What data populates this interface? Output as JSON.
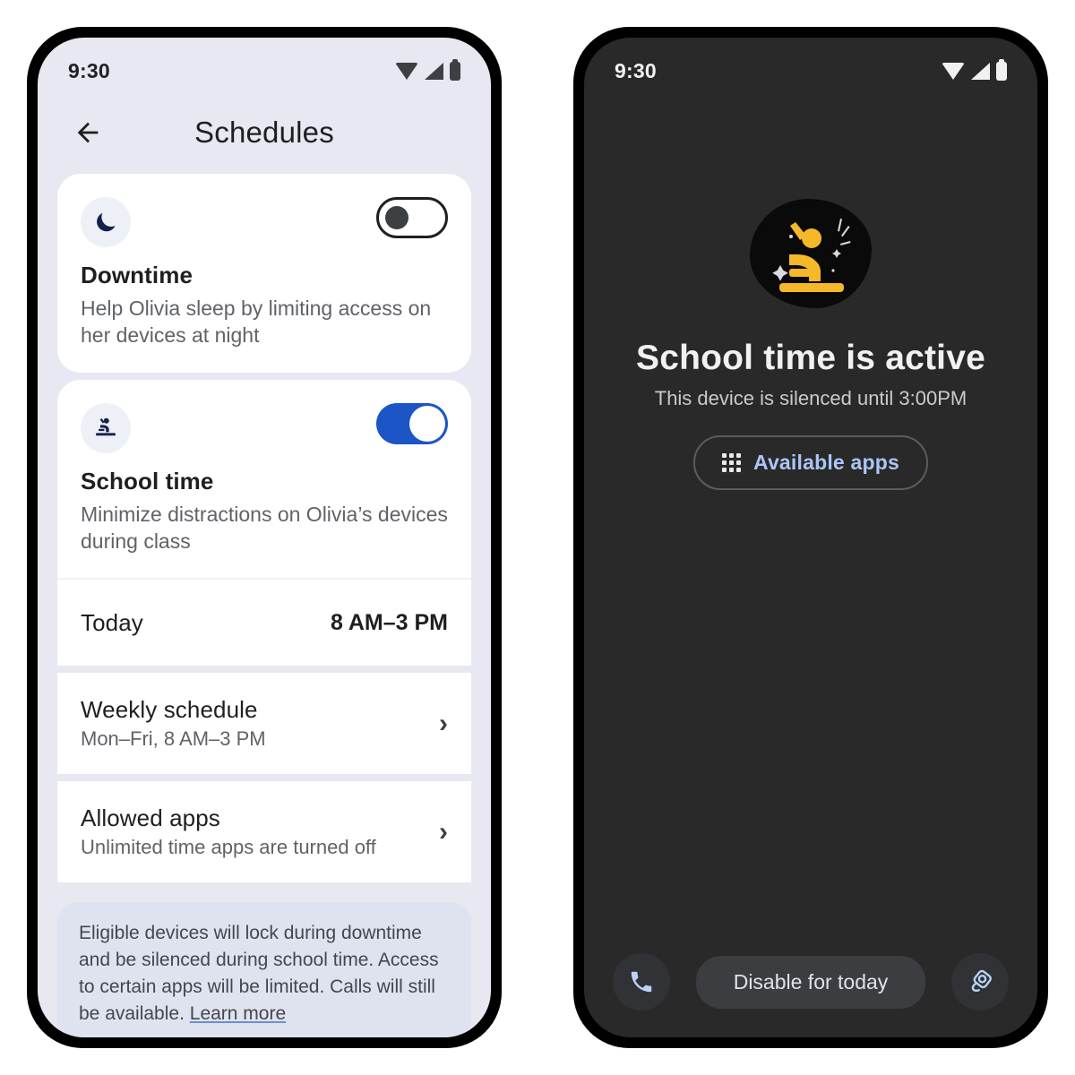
{
  "left_phone": {
    "status_bar": {
      "time": "9:30",
      "icons": [
        "wifi-icon",
        "signal-icon",
        "battery-icon"
      ]
    },
    "appbar": {
      "back_icon": "arrow-back-icon",
      "title": "Schedules"
    },
    "downtime_card": {
      "icon": "moon-icon",
      "toggle_state": "off",
      "title": "Downtime",
      "description": "Help Olivia sleep by limiting access on her devices at night"
    },
    "school_time_card": {
      "icon": "school-time-icon",
      "toggle_state": "on",
      "title": "School time",
      "description": "Minimize distractions on Olivia’s devices during class"
    },
    "rows": [
      {
        "title": "Today",
        "value": "8 AM–3 PM",
        "sub": "",
        "chevron": ""
      },
      {
        "title": "Weekly schedule",
        "sub": "Mon–Fri, 8 AM–3 PM",
        "value": "",
        "chevron": "›"
      },
      {
        "title": "Allowed apps",
        "sub": "Unlimited time apps are turned off",
        "value": "",
        "chevron": "›"
      }
    ],
    "note": {
      "text": "Eligible devices will lock during downtime and be silenced during school time. Access to certain apps will be limited. Calls will still be available. ",
      "link_label": "Learn more"
    }
  },
  "right_phone": {
    "status_bar": {
      "time": "9:30",
      "icons": [
        "wifi-icon",
        "signal-icon",
        "battery-icon"
      ]
    },
    "hero": {
      "icon": "school-time-illustration",
      "title": "School time is active",
      "subtitle": "This device is silenced until 3:00PM"
    },
    "available_apps_button": {
      "icon": "apps-grid-icon",
      "label": "Available apps"
    },
    "bottom_bar": {
      "phone_icon": "phone-icon",
      "disable_label": "Disable for today",
      "camera_icon": "camera-icon"
    }
  },
  "colors": {
    "page_bg_light": "#e7e8f2",
    "card_white": "#ffffff",
    "toggle_on_blue": "#1b55c6",
    "dark_bg": "#292929",
    "accent_blue": "#aac6f6",
    "hero_yellow": "#f5b828",
    "link_underline": "#6b8fd6"
  }
}
